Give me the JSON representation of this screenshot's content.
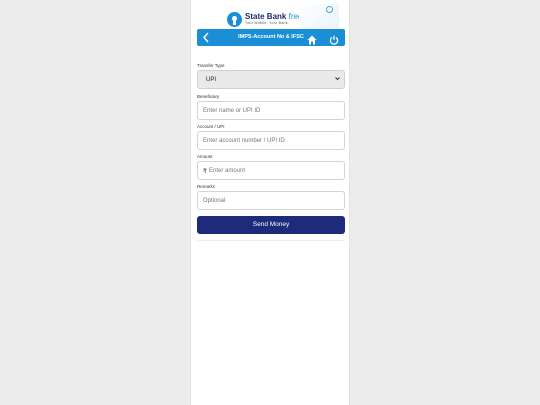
{
  "header": {
    "brand_name": "State Bank",
    "brand_product": "freedoM",
    "tagline": "Your Mobile. Your Bank.",
    "page_title": "IMPS-Account No & IFSC"
  },
  "form": {
    "transfer_type": {
      "label": "Transfer Type",
      "value": "UPI"
    },
    "beneficiary": {
      "label": "Beneficiary",
      "placeholder": "Enter name or UPI ID"
    },
    "account": {
      "label": "Account / UPI",
      "placeholder": "Enter account number / UPI ID"
    },
    "amount": {
      "label": "Amount",
      "currency": "₹",
      "placeholder": "Enter amount"
    },
    "remarks": {
      "label": "Remarks",
      "placeholder": "Optional"
    },
    "submit_label": "Send Money"
  },
  "colors": {
    "nav_blue": "#1a8fd6",
    "button_navy": "#1e2a7a",
    "brand_navy": "#1e2a78"
  },
  "icons": [
    "sbi-logo-icon",
    "clock-icon",
    "back-arrow-icon",
    "home-icon",
    "power-icon",
    "chevron-down-icon"
  ]
}
